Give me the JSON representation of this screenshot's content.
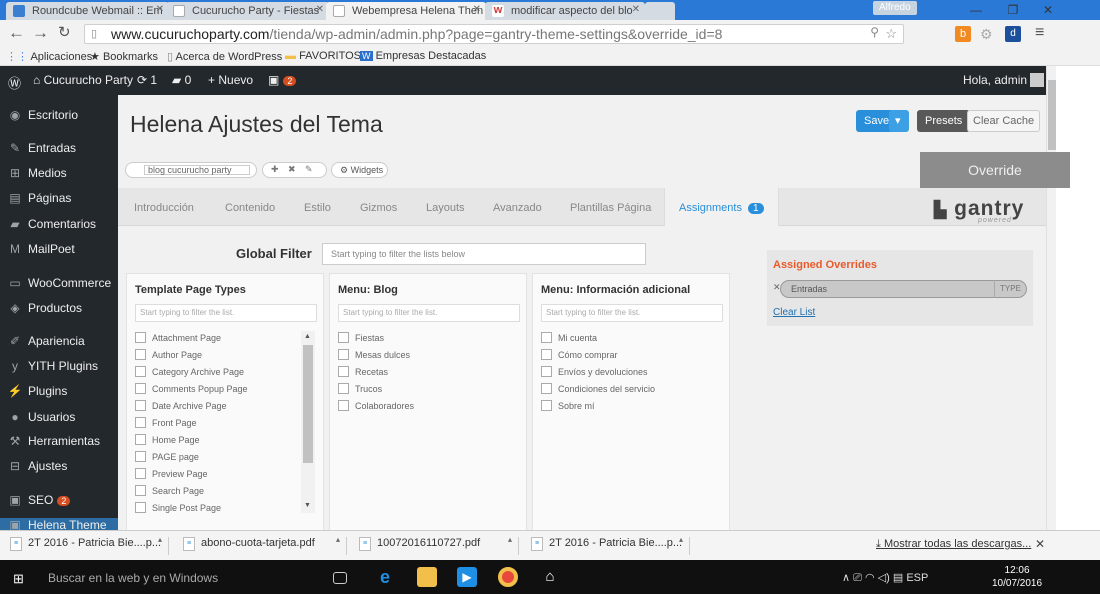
{
  "browser": {
    "tabs": [
      {
        "label": "Roundcube Webmail :: Em",
        "icon_color": "#3a7ecf"
      },
      {
        "label": "Cucurucho Party - Fiestas",
        "icon_color": "#e0e0e0"
      },
      {
        "label": "Webempresa Helena Then",
        "icon_color": "#e0e0e0"
      },
      {
        "label": "modificar aspecto del blo",
        "icon_color": "#d63a3a"
      }
    ],
    "profile_name": "Alfredo",
    "url_domain": "www.cucuruchoparty.com",
    "url_path": "/tienda/wp-admin/admin.php?page=gantry-theme-settings&override_id=8",
    "bookmarks": [
      "Aplicaciones",
      "Bookmarks",
      "Acerca de WordPress",
      "FAVORITOS",
      "Empresas Destacadas"
    ]
  },
  "adminbar": {
    "site_name": "Cucurucho Party",
    "updates": "1",
    "comments": "0",
    "new_label": "Nuevo",
    "plugin_badge": "2",
    "greeting": "Hola, admin"
  },
  "sidebar": {
    "items": [
      {
        "label": "Escritorio",
        "icon": "dashboard-icon"
      },
      {
        "label": "Entradas",
        "icon": "pin-icon"
      },
      {
        "label": "Medios",
        "icon": "media-icon"
      },
      {
        "label": "Páginas",
        "icon": "pages-icon"
      },
      {
        "label": "Comentarios",
        "icon": "comments-icon"
      },
      {
        "label": "MailPoet",
        "icon": "mailpoet-icon"
      },
      {
        "label": "WooCommerce",
        "icon": "woo-icon"
      },
      {
        "label": "Productos",
        "icon": "products-icon"
      },
      {
        "label": "Apariencia",
        "icon": "brush-icon"
      },
      {
        "label": "YITH Plugins",
        "icon": "yith-icon"
      },
      {
        "label": "Plugins",
        "icon": "plugin-icon"
      },
      {
        "label": "Usuarios",
        "icon": "users-icon"
      },
      {
        "label": "Herramientas",
        "icon": "wrench-icon"
      },
      {
        "label": "Ajustes",
        "icon": "settings-icon"
      },
      {
        "label": "SEO",
        "icon": "seo-icon",
        "badge": "2"
      },
      {
        "label": "Helena Theme",
        "icon": "theme-icon"
      }
    ]
  },
  "page": {
    "title": "Helena Ajustes del Tema",
    "save_label": "Save",
    "presets_label": "Presets",
    "clear_cache_label": "Clear Cache",
    "outline_value": "blog cucurucho party",
    "widgets_label": "Widgets",
    "override_label": "Override",
    "tabs": [
      "Introducción",
      "Contenido",
      "Estilo",
      "Gizmos",
      "Layouts",
      "Avanzado",
      "Plantillas Página",
      "Assignments"
    ],
    "assignments_count": "1",
    "logo_text": "gantry",
    "logo_sub": "powered",
    "global_filter_label": "Global Filter",
    "global_filter_placeholder": "Start typing to filter the lists below"
  },
  "cards": [
    {
      "title": "Template Page Types",
      "filter_placeholder": "Start typing to filter the list.",
      "items": [
        "Attachment Page",
        "Author Page",
        "Category Archive Page",
        "Comments Popup Page",
        "Date Archive Page",
        "Front Page",
        "Home Page",
        "PAGE page",
        "Preview Page",
        "Search Page",
        "Single Post Page"
      ]
    },
    {
      "title": "Menu: Blog",
      "filter_placeholder": "Start typing to filter the list.",
      "items": [
        "Fiestas",
        "Mesas dulces",
        "Recetas",
        "Trucos",
        "Colaboradores"
      ]
    },
    {
      "title": "Menu: Información adicional",
      "filter_placeholder": "Start typing to filter the list.",
      "items": [
        "Mi cuenta",
        "Cómo comprar",
        "Envíos y devoluciones",
        "Condiciones del servicio",
        "Sobre mí"
      ]
    }
  ],
  "assigned": {
    "title": "Assigned Overrides",
    "entry": "Entradas",
    "type_label": "TYPE",
    "clear_label": "Clear List"
  },
  "downloads": {
    "items": [
      "2T 2016 - Patricia Bie....p...",
      "abono-cuota-tarjeta.pdf",
      "10072016110727.pdf",
      "2T 2016 - Patricia Bie....p..."
    ],
    "show_all": "Mostrar todas las descargas..."
  },
  "taskbar": {
    "search_placeholder": "Buscar en la web y en Windows",
    "lang": "ESP",
    "time": "12:06",
    "date": "10/07/2016"
  }
}
